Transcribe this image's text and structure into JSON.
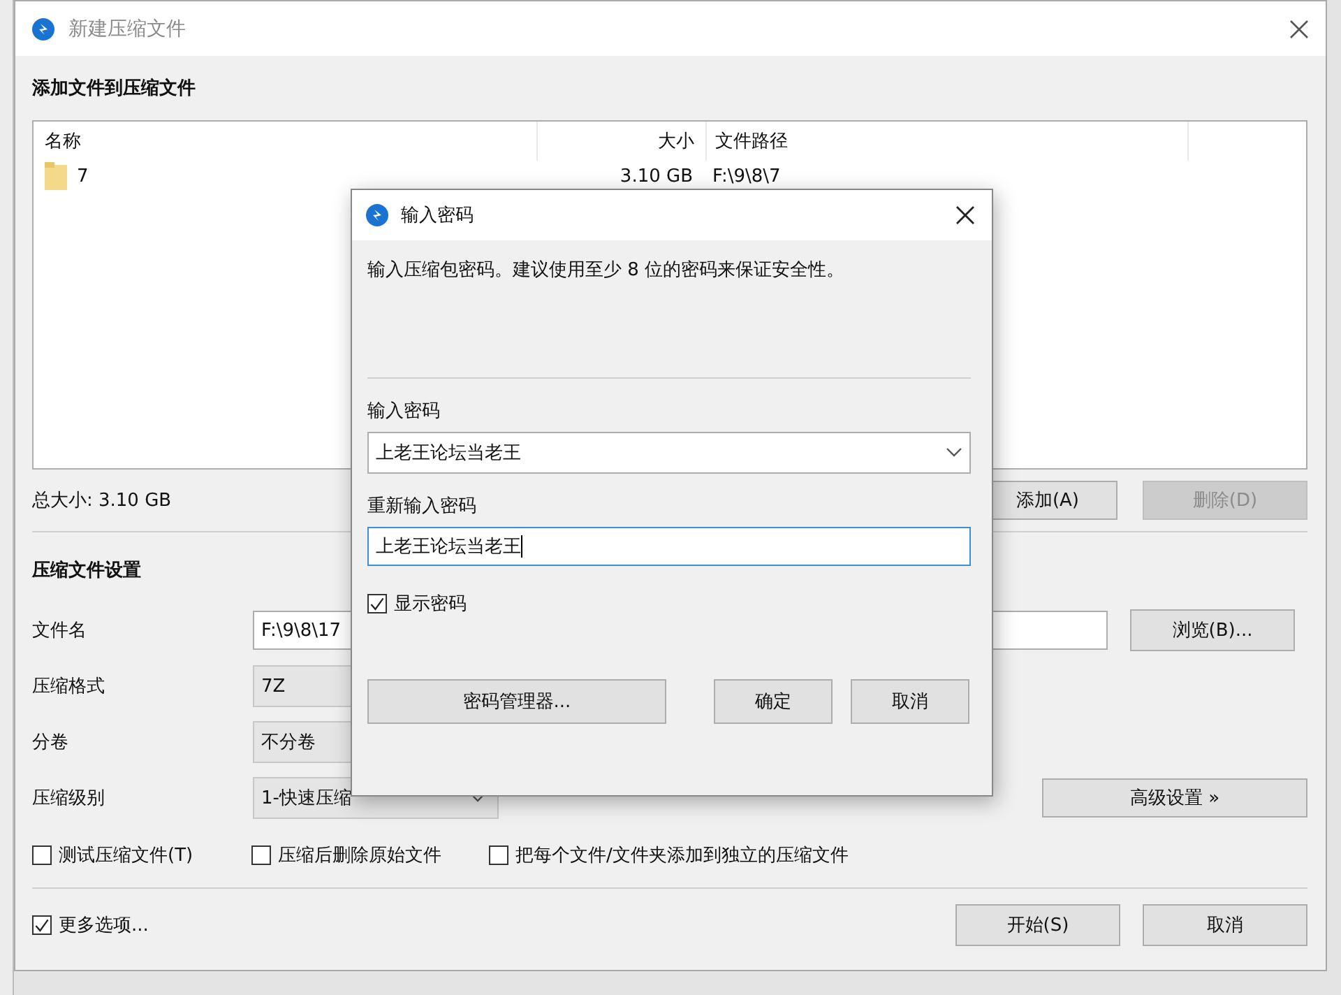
{
  "window": {
    "title": "新建压缩文件"
  },
  "main": {
    "heading": "添加文件到压缩文件",
    "file_list": {
      "columns": [
        "名称",
        "大小",
        "文件路径"
      ],
      "rows": [
        {
          "name": "7",
          "size": "3.10 GB",
          "path": "F:\\9\\8\\7"
        }
      ]
    },
    "total_size": "总大小: 3.10 GB",
    "list_buttons": [
      {
        "label": "添加(A)",
        "disabled": false
      },
      {
        "label": "删除(D)",
        "disabled": true
      }
    ],
    "settings_heading": "压缩文件设置",
    "fields": [
      {
        "label": "文件名",
        "value": "F:\\9\\8\\17",
        "kind": "text"
      },
      {
        "label": "压缩格式",
        "value": "7Z",
        "kind": "select"
      },
      {
        "label": "分卷",
        "value": "不分卷",
        "kind": "select"
      },
      {
        "label": "压缩级别",
        "value": "1-快速压缩",
        "kind": "select"
      }
    ],
    "browse_button": "浏览(B)...",
    "advanced_button": "高级设置 »",
    "options": [
      {
        "label": "测试压缩文件(T)",
        "checked": false
      },
      {
        "label": "压缩后删除原始文件",
        "checked": false
      },
      {
        "label": "把每个文件/文件夹添加到独立的压缩文件",
        "checked": false
      }
    ],
    "more_options": {
      "label": "更多选项...",
      "checked": true
    },
    "buttons": [
      "开始(S)",
      "取消"
    ]
  },
  "dialog": {
    "title": "输入密码",
    "description": "输入压缩包密码。建议使用至少 8 位的密码来保证安全性。",
    "password_label": "输入密码",
    "password_value": "上老王论坛当老王",
    "confirm_label": "重新输入密码",
    "confirm_value": "上老王论坛当老王",
    "show_password": {
      "label": "显示密码",
      "checked": true
    },
    "manager_button": "密码管理器...",
    "buttons": [
      "确定",
      "取消"
    ]
  }
}
